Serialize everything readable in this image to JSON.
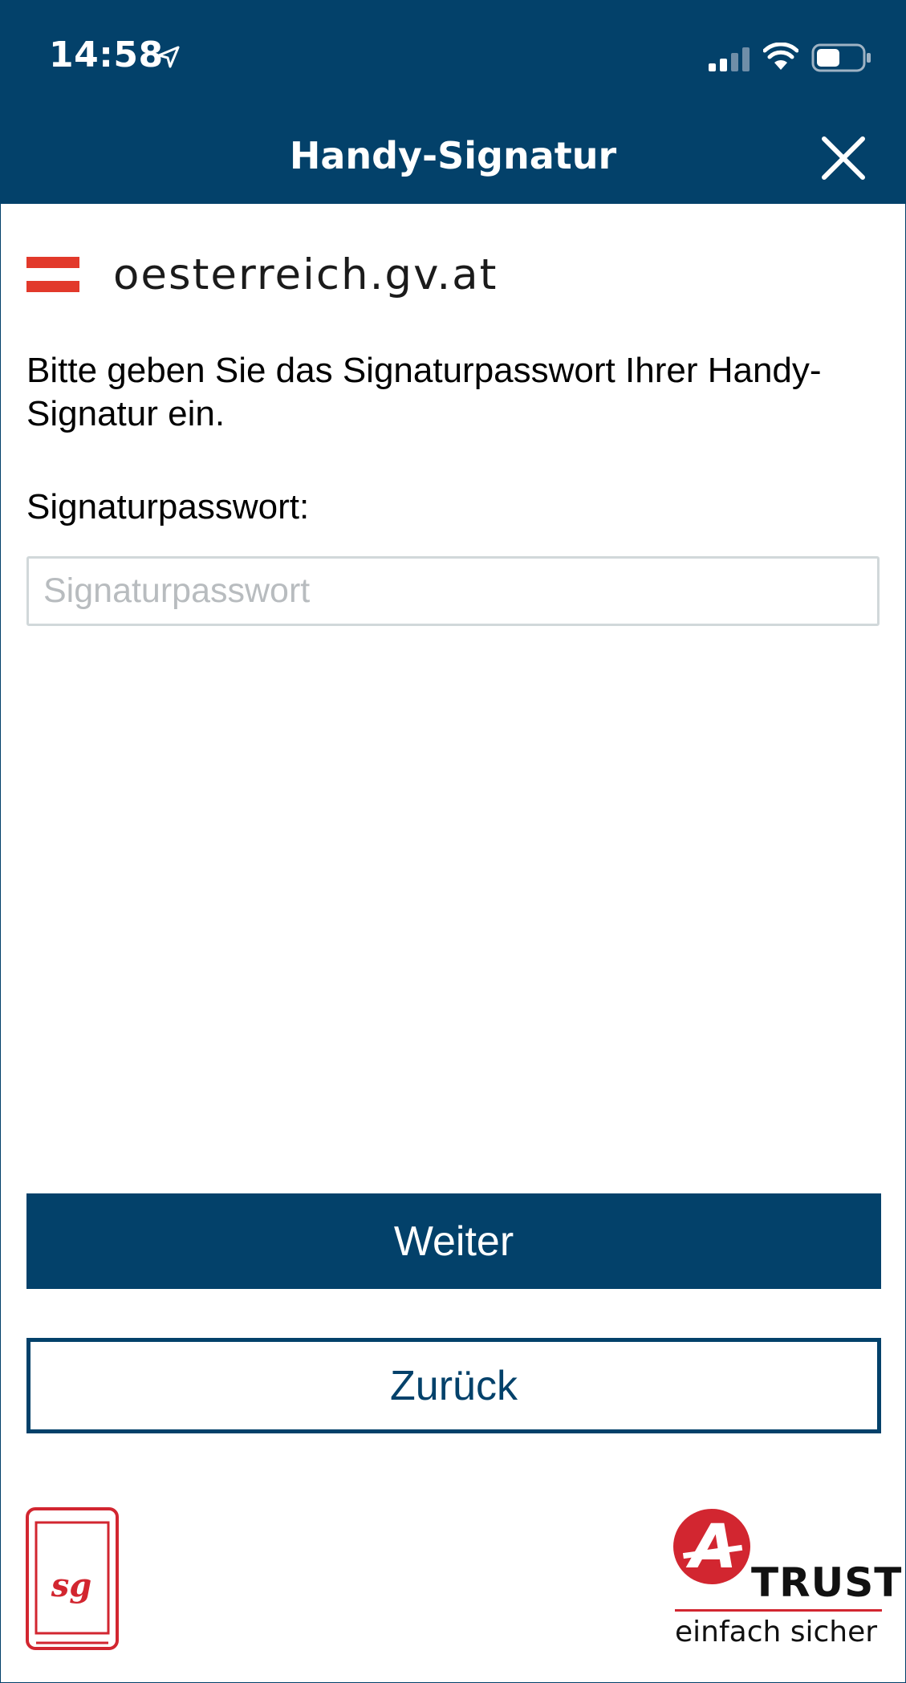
{
  "status_bar": {
    "time": "14:58"
  },
  "header": {
    "title": "Handy-Signatur"
  },
  "brand": {
    "name": "oesterreich.gv.at"
  },
  "form": {
    "instruction": "Bitte geben Sie das Signaturpasswort Ihrer Handy-Signatur ein.",
    "field_label": "Signaturpasswort:",
    "password_placeholder": "Signaturpasswort",
    "password_value": ""
  },
  "actions": {
    "primary_label": "Weiter",
    "secondary_label": "Zurück"
  },
  "footer": {
    "atrust_name": "TRUST",
    "atrust_tagline": "einfach sicher",
    "handy_signatur_logo_text": "sg",
    "atrust_logo_letter": "A"
  },
  "colors": {
    "primary": "#03416a",
    "flag_red": "#e2392b",
    "logo_red": "#d22630",
    "input_border": "#d1d8da",
    "placeholder": "#b8bcbf"
  },
  "icons": {
    "status_bar": [
      "location-arrow-icon",
      "cellular-signal-icon",
      "wifi-icon",
      "battery-icon"
    ],
    "header": [
      "close-icon"
    ]
  }
}
